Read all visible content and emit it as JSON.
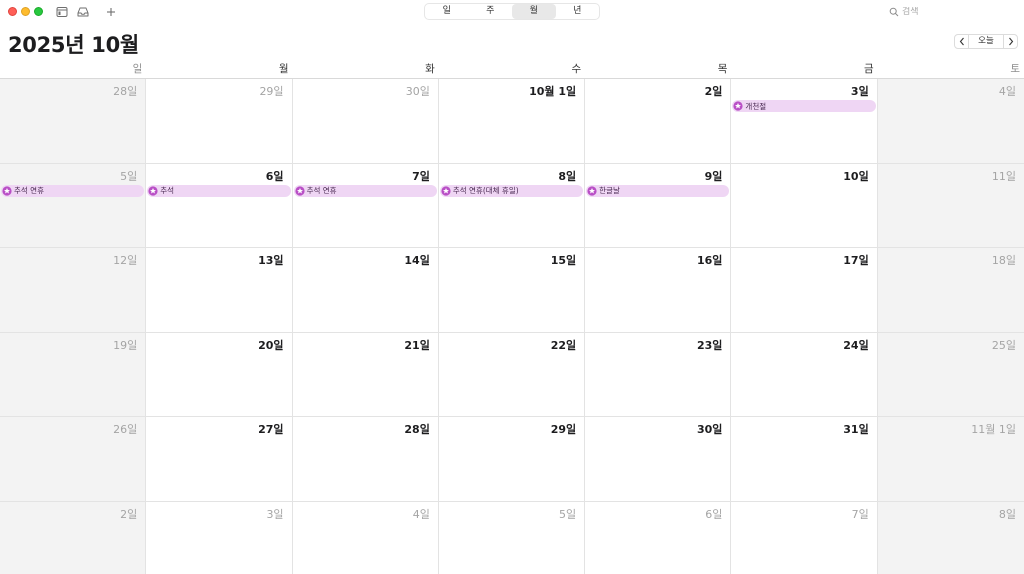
{
  "toolbar": {
    "icons": [
      "calendar-icon",
      "inbox-icon",
      "plus-icon"
    ],
    "views": [
      {
        "label": "일",
        "active": false
      },
      {
        "label": "주",
        "active": false
      },
      {
        "label": "월",
        "active": true
      },
      {
        "label": "년",
        "active": false
      }
    ],
    "search_placeholder": "검색"
  },
  "header": {
    "title": "2025년 10월",
    "today_label": "오늘"
  },
  "weekdays": [
    "일",
    "월",
    "화",
    "수",
    "목",
    "금",
    "토"
  ],
  "colors": {
    "event_bg": "#efd6f4",
    "event_icon": "#b94fc6",
    "weekend_bg": "#f3f3f3"
  },
  "days": [
    {
      "label": "28일",
      "other": true
    },
    {
      "label": "29일",
      "other": true
    },
    {
      "label": "30일",
      "other": true
    },
    {
      "label": "10월 1일",
      "other": false
    },
    {
      "label": "2일",
      "other": false
    },
    {
      "label": "3일",
      "other": false,
      "event": "개천절"
    },
    {
      "label": "4일",
      "other": false
    },
    {
      "label": "5일",
      "other": false,
      "event": "추석 연휴"
    },
    {
      "label": "6일",
      "other": false,
      "event": "추석"
    },
    {
      "label": "7일",
      "other": false,
      "event": "추석 연휴"
    },
    {
      "label": "8일",
      "other": false,
      "event": "추석 연휴(대체 휴일)"
    },
    {
      "label": "9일",
      "other": false,
      "event": "한글날"
    },
    {
      "label": "10일",
      "other": false
    },
    {
      "label": "11일",
      "other": false
    },
    {
      "label": "12일",
      "other": false
    },
    {
      "label": "13일",
      "other": false
    },
    {
      "label": "14일",
      "other": false
    },
    {
      "label": "15일",
      "other": false
    },
    {
      "label": "16일",
      "other": false
    },
    {
      "label": "17일",
      "other": false
    },
    {
      "label": "18일",
      "other": false
    },
    {
      "label": "19일",
      "other": false
    },
    {
      "label": "20일",
      "other": false
    },
    {
      "label": "21일",
      "other": false
    },
    {
      "label": "22일",
      "other": false
    },
    {
      "label": "23일",
      "other": false
    },
    {
      "label": "24일",
      "other": false
    },
    {
      "label": "25일",
      "other": false
    },
    {
      "label": "26일",
      "other": false
    },
    {
      "label": "27일",
      "other": false
    },
    {
      "label": "28일",
      "other": false
    },
    {
      "label": "29일",
      "other": false
    },
    {
      "label": "30일",
      "other": false
    },
    {
      "label": "31일",
      "other": false
    },
    {
      "label": "11월 1일",
      "other": true
    },
    {
      "label": "2일",
      "other": true
    },
    {
      "label": "3일",
      "other": true
    },
    {
      "label": "4일",
      "other": true
    },
    {
      "label": "5일",
      "other": true
    },
    {
      "label": "6일",
      "other": true
    },
    {
      "label": "7일",
      "other": true
    },
    {
      "label": "8일",
      "other": true
    }
  ]
}
